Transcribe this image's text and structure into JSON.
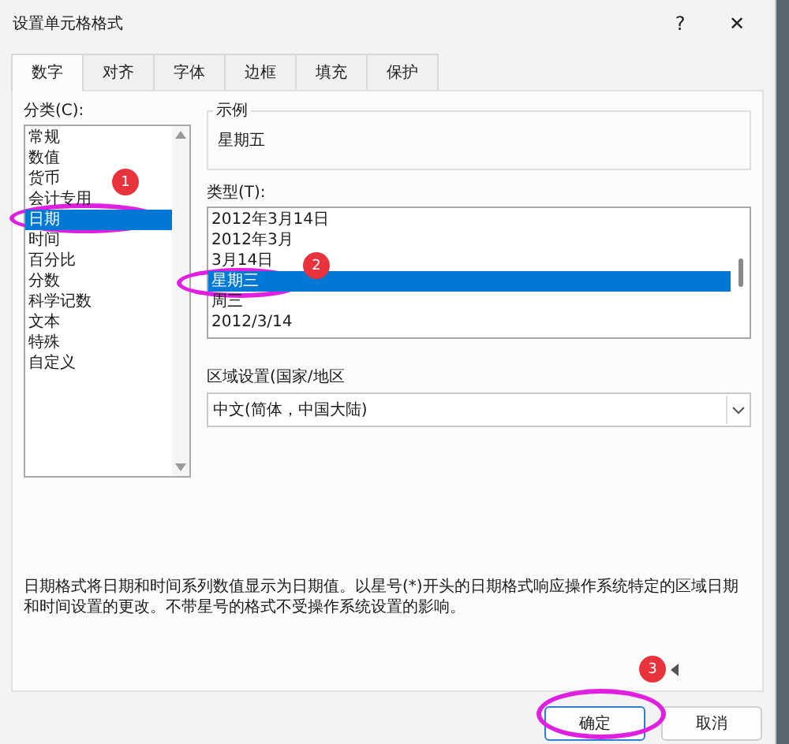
{
  "window": {
    "title": "设置单元格格式",
    "help": "?",
    "close": "✕"
  },
  "tabs": [
    {
      "label": "数字",
      "selected": true
    },
    {
      "label": "对齐",
      "selected": false
    },
    {
      "label": "字体",
      "selected": false
    },
    {
      "label": "边框",
      "selected": false
    },
    {
      "label": "填充",
      "selected": false
    },
    {
      "label": "保护",
      "selected": false
    }
  ],
  "category": {
    "label": "分类(C):",
    "items": [
      {
        "label": "常规",
        "selected": false
      },
      {
        "label": "数值",
        "selected": false
      },
      {
        "label": "货币",
        "selected": false
      },
      {
        "label": "会计专用",
        "selected": false
      },
      {
        "label": "日期",
        "selected": true
      },
      {
        "label": "时间",
        "selected": false
      },
      {
        "label": "百分比",
        "selected": false
      },
      {
        "label": "分数",
        "selected": false
      },
      {
        "label": "科学记数",
        "selected": false
      },
      {
        "label": "文本",
        "selected": false
      },
      {
        "label": "特殊",
        "selected": false
      },
      {
        "label": "自定义",
        "selected": false
      }
    ]
  },
  "sample": {
    "label": "示例",
    "value": "星期五"
  },
  "type": {
    "label": "类型(T):",
    "items": [
      {
        "label": "2012年3月14日",
        "selected": false
      },
      {
        "label": "2012年3月",
        "selected": false
      },
      {
        "label": "3月14日",
        "selected": false
      },
      {
        "label": "星期三",
        "selected": true
      },
      {
        "label": "周三",
        "selected": false
      },
      {
        "label": "2012/3/14",
        "selected": false
      }
    ]
  },
  "locale": {
    "label": "区域设置(国家/地区",
    "value": "中文(简体，中国大陆)"
  },
  "description": "日期格式将日期和时间系列数值显示为日期值。以星号(*)开头的日期格式响应操作系统特定的区域日期和时间设置的更改。不带星号的格式不受操作系统设置的影响。",
  "buttons": [
    {
      "label": "确定",
      "kind": "primary"
    },
    {
      "label": "取消",
      "kind": "secondary"
    }
  ],
  "annotations": [
    {
      "label": "1"
    },
    {
      "label": "2"
    },
    {
      "label": "3"
    }
  ]
}
